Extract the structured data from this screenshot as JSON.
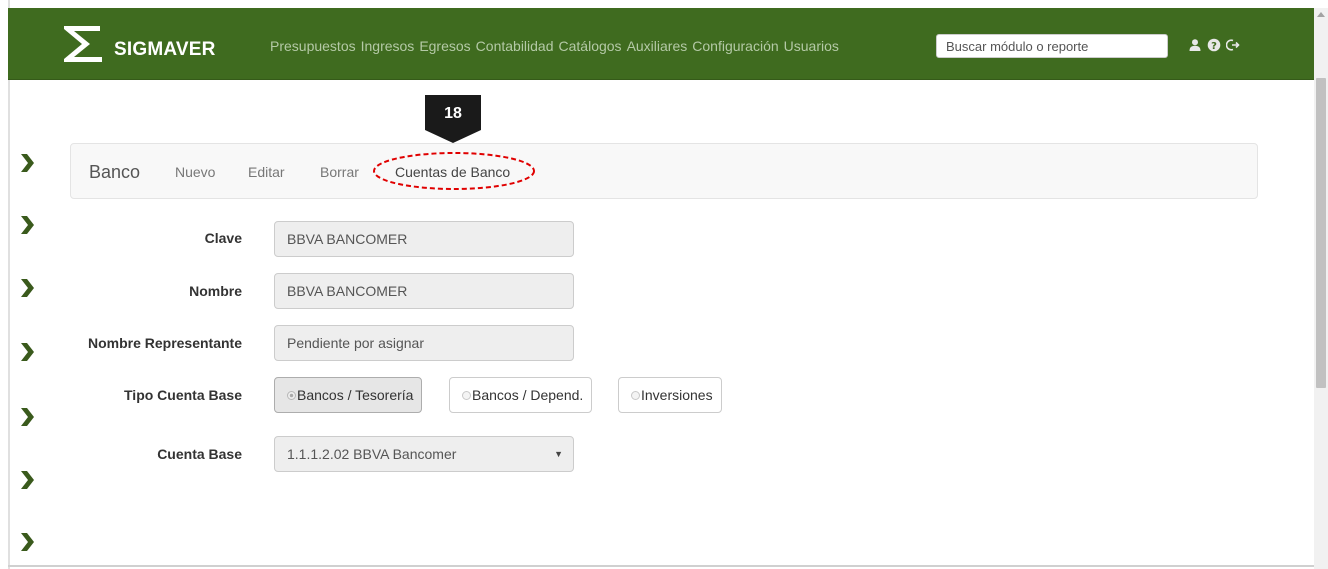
{
  "app": {
    "name": "SIGMAVER"
  },
  "nav": {
    "links": [
      "Presupuestos",
      "Ingresos",
      "Egresos",
      "Contabilidad",
      "Catálogos",
      "Auxiliares",
      "Configuración",
      "Usuarios"
    ],
    "search_placeholder": "Buscar módulo o reporte",
    "icons": [
      "user-icon",
      "help-icon",
      "logout-icon"
    ]
  },
  "callout": {
    "number": "18"
  },
  "actionbar": {
    "title": "Banco",
    "items": [
      "Nuevo",
      "Editar",
      "Borrar",
      "Cuentas de Banco"
    ],
    "highlighted_item": "Cuentas de Banco"
  },
  "form": {
    "clave": {
      "label": "Clave",
      "value": "BBVA BANCOMER"
    },
    "nombre": {
      "label": "Nombre",
      "value": "BBVA BANCOMER"
    },
    "representante": {
      "label": "Nombre Representante",
      "value": "Pendiente por asignar"
    },
    "tipo": {
      "label": "Tipo Cuenta Base",
      "options": [
        "Bancos / Tesorería",
        "Bancos / Depend.",
        "Inversiones"
      ],
      "selected": "Bancos / Tesorería"
    },
    "cuenta_base": {
      "label": "Cuenta Base",
      "value": "1.1.1.2.02 BBVA Bancomer"
    }
  },
  "colors": {
    "navbar": "#3f6b1f",
    "nav_link": "#b4c9a6",
    "chevron": "#3a5a1c",
    "callout": "#1a1a1a",
    "highlight": "#e00000"
  }
}
